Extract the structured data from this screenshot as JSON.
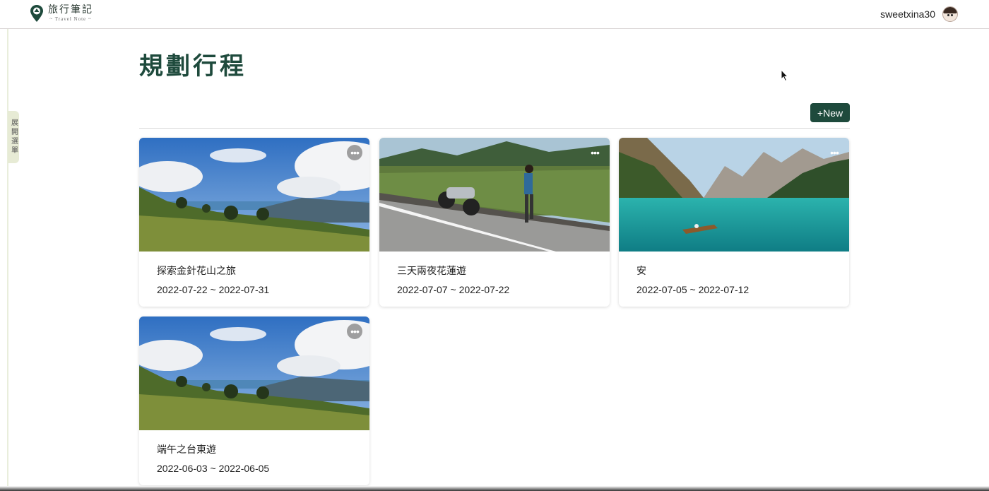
{
  "header": {
    "logo_title": "旅行筆記",
    "logo_subtitle": "~ Travel Note ~",
    "username": "sweetxina30"
  },
  "sidebar": {
    "toggle_label": "展開選單"
  },
  "page": {
    "title": "規劃行程",
    "new_button": "+New"
  },
  "trips": [
    {
      "title": "探索金針花山之旅",
      "dates": "2022-07-22 ~ 2022-07-31",
      "image": "mountain-meadow",
      "more": "•••"
    },
    {
      "title": "三天兩夜花蓮遊",
      "dates": "2022-07-07 ~ 2022-07-22",
      "image": "motorcycle-roadside",
      "more": "•••"
    },
    {
      "title": "安",
      "dates": "2022-07-05 ~ 2022-07-12",
      "image": "mountain-lake-boat",
      "more": "•••"
    },
    {
      "title": "端午之台東遊",
      "dates": "2022-06-03 ~ 2022-06-05",
      "image": "mountain-meadow",
      "more": "•••"
    }
  ],
  "colors": {
    "brand": "#1e4a3c",
    "sidebar_tab": "#e7ebd5"
  }
}
